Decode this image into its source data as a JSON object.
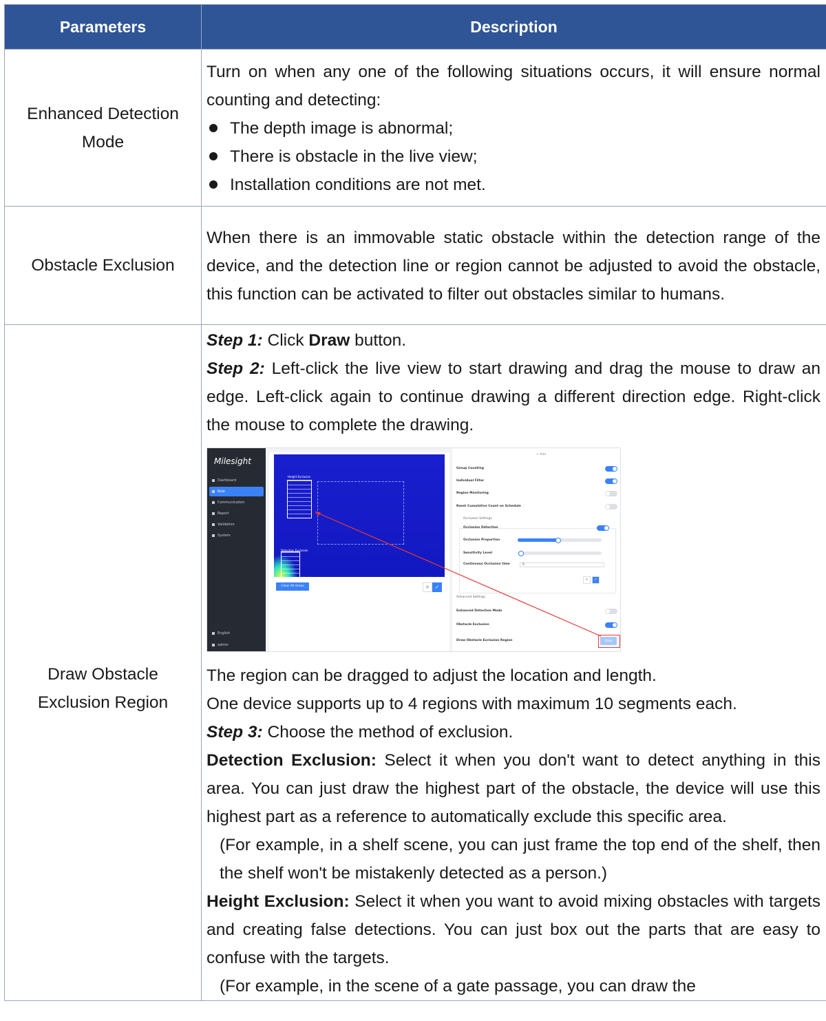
{
  "table": {
    "headers": {
      "parameters": "Parameters",
      "description": "Description"
    },
    "rows": [
      {
        "parameter": [
          "Enhanced Detection",
          "Mode"
        ],
        "intro": "Turn on when any one of the following situations occurs, it will ensure normal counting and detecting:",
        "bullets": [
          "The depth image is abnormal;",
          "There is obstacle in the live view;",
          "Installation conditions are not met."
        ]
      },
      {
        "parameter": [
          "Obstacle Exclusion"
        ],
        "text": "When there is an immovable static obstacle within the detection range of the device, and the detection line or region cannot be adjusted to avoid the obstacle, this function can be activated to filter out obstacles similar to humans."
      },
      {
        "parameter": [
          "Draw Obstacle",
          "Exclusion Region"
        ],
        "step1_label": "Step 1:",
        "step1_pre": " Click ",
        "step1_bold": "Draw",
        "step1_post": " button.",
        "step2_label": "Step 2:",
        "step2_text": " Left-click the live view to start drawing and drag the mouse to draw an edge. Left-click again to continue drawing a different direction edge. Right-click the mouse to complete the drawing.",
        "para_drag": "The region can be dragged to adjust the location and length.",
        "para_support": "One device supports up to 4 regions with maximum 10 segments each.",
        "step3_label": "Step 3:",
        "step3_text": " Choose the method of exclusion.",
        "detection_label": "Detection Exclusion:",
        "detection_text": " Select it when you don't want to detect anything in this area. You can just draw the highest part of the obstacle, the device will use this highest part as a reference to automatically exclude this specific area.",
        "detection_example": "(For example, in a shelf scene, you can just frame the top end of the shelf, then the shelf won't be mistakenly detected as a person.)",
        "height_label": "Height Exclusion:",
        "height_text": " Select it when you want to avoid mixing obstacles with targets and creating false detections. You can just box out the parts that are easy to confuse with the targets.",
        "height_example": "(For example, in the scene of a gate passage, you can draw the"
      }
    ]
  },
  "screenshot": {
    "logo": "Milesight",
    "nav": [
      "Dashboard",
      "Rule",
      "Communication",
      "Report",
      "Validation",
      "System"
    ],
    "nav_active": "Rule",
    "footer_nav": [
      "English",
      "admin"
    ],
    "overlay_height": "Height Exclusion",
    "overlay_detection": "Detection Exclusion",
    "clear_button": "Clear All Areas",
    "add": "+ Add",
    "settings": [
      "Group Counting",
      "Individual Filter",
      "Region Monitoring",
      "Reset Cumulative Count on Schedule"
    ],
    "occlusion_header": "Occlusion Settings",
    "occlusion_items": [
      "Occlusion Detection",
      "Occlusion Proportion",
      "Sensitivity Level",
      "Continuous Occlusion time"
    ],
    "occlusion_time_value": "5",
    "advanced": "Advanced Settings",
    "advanced_items": [
      "Enhanced Detection Mode",
      "Obstacle Exclusion",
      "Draw Obstacle Exclusion Region"
    ],
    "draw_button": "Draw",
    "accent": "#3b82f6",
    "header_color": "#2f5597"
  }
}
